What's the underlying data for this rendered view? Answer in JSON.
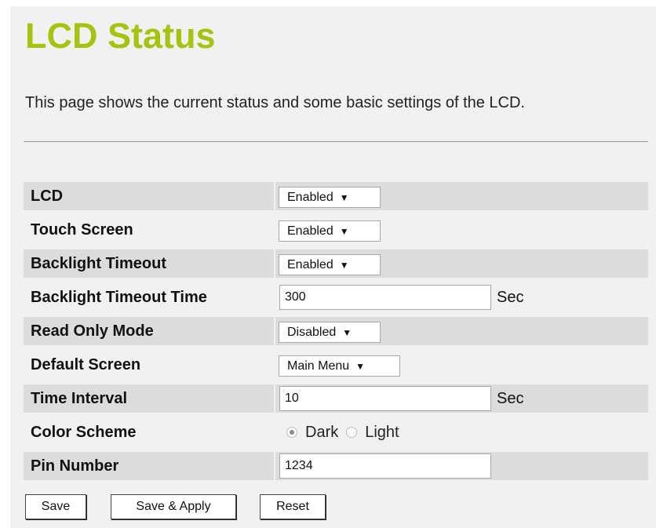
{
  "page": {
    "title": "LCD Status",
    "description": "This page shows the current status and some basic settings of the LCD."
  },
  "fields": {
    "lcd": {
      "label": "LCD",
      "value": "Enabled"
    },
    "touch_screen": {
      "label": "Touch Screen",
      "value": "Enabled"
    },
    "backlight_timeout": {
      "label": "Backlight Timeout",
      "value": "Enabled"
    },
    "backlight_timeout_time": {
      "label": "Backlight Timeout Time",
      "value": "300",
      "unit": "Sec"
    },
    "read_only_mode": {
      "label": "Read Only Mode",
      "value": "Disabled"
    },
    "default_screen": {
      "label": "Default Screen",
      "value": "Main Menu"
    },
    "time_interval": {
      "label": "Time Interval",
      "value": "10",
      "unit": "Sec"
    },
    "color_scheme": {
      "label": "Color Scheme",
      "options": [
        "Dark",
        "Light"
      ],
      "selected": "Dark"
    },
    "pin_number": {
      "label": "Pin Number",
      "value": "1234"
    }
  },
  "buttons": {
    "save": "Save",
    "save_apply": "Save & Apply",
    "reset": "Reset"
  },
  "colors": {
    "title": "#a6c30f",
    "panel_bg": "#f1f1f1",
    "row_alt_bg": "#dcdcdc"
  },
  "icons": {
    "dropdown": "triangle-down-icon"
  }
}
